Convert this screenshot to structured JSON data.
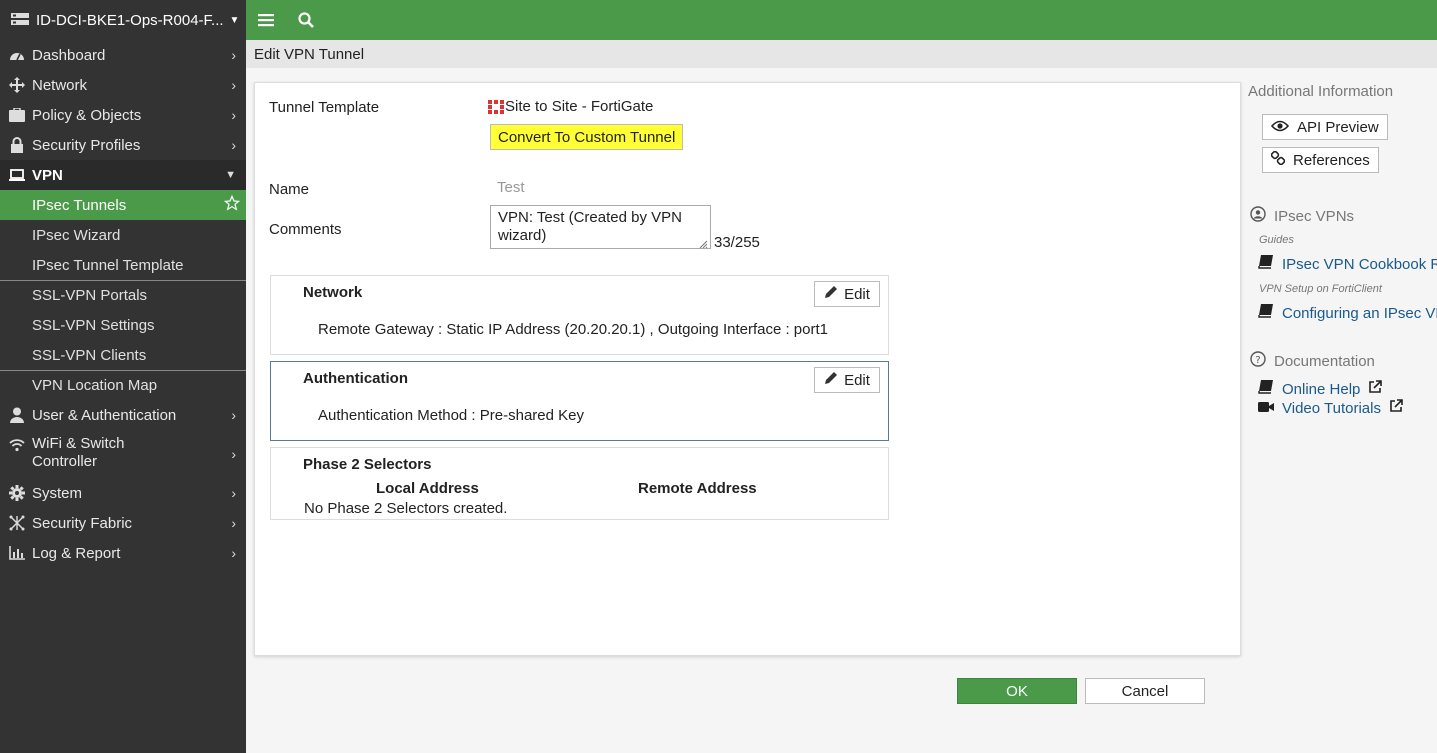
{
  "device": {
    "name": "ID-DCI-BKE1-Ops-R004-F..."
  },
  "nav": {
    "dashboard": "Dashboard",
    "network": "Network",
    "policy": "Policy & Objects",
    "security_profiles": "Security Profiles",
    "vpn": "VPN",
    "vpn_items": {
      "ipsec_tunnels": "IPsec Tunnels",
      "ipsec_wizard": "IPsec Wizard",
      "ipsec_tunnel_template": "IPsec Tunnel Template",
      "ssl_vpn_portals": "SSL-VPN Portals",
      "ssl_vpn_settings": "SSL-VPN Settings",
      "ssl_vpn_clients": "SSL-VPN Clients",
      "vpn_location_map": "VPN Location Map"
    },
    "user_auth": "User & Authentication",
    "wifi_line1": "WiFi & Switch",
    "wifi_line2": "Controller",
    "system": "System",
    "security_fabric": "Security Fabric",
    "log_report": "Log & Report"
  },
  "page": {
    "title": "Edit VPN Tunnel"
  },
  "form": {
    "tunnel_template_label": "Tunnel Template",
    "tunnel_template_value": "Site to Site - FortiGate",
    "convert_button": "Convert To Custom Tunnel",
    "name_label": "Name",
    "name_value": "Test",
    "comments_label": "Comments",
    "comments_value": "VPN: Test (Created by VPN wizard)",
    "comments_count": "33/255"
  },
  "sections": {
    "network": {
      "title": "Network",
      "edit": "Edit",
      "body": "Remote Gateway : Static IP Address (20.20.20.1) , Outgoing Interface : port1"
    },
    "auth": {
      "title": "Authentication",
      "edit": "Edit",
      "body": "Authentication Method : Pre-shared Key"
    },
    "phase2": {
      "title": "Phase 2 Selectors",
      "col_local": "Local Address",
      "col_remote": "Remote Address",
      "empty": "No Phase 2 Selectors created."
    }
  },
  "info": {
    "header": "Additional Information",
    "api_preview": "API Preview",
    "references": "References",
    "ipsec_vpns": "IPsec VPNs",
    "guides": "Guides",
    "cookbook": "IPsec VPN Cookbook Re",
    "forticlient_caption": "VPN Setup on FortiClient",
    "configuring": "Configuring an IPsec VP",
    "documentation": "Documentation",
    "online_help": "Online Help",
    "video_tutorials": "Video Tutorials"
  },
  "footer": {
    "ok": "OK",
    "cancel": "Cancel"
  },
  "colors": {
    "brand_green": "#4a9a4a",
    "sidebar_bg": "#333333",
    "highlight_yellow": "#ffff33",
    "link_blue": "#1a5a8a"
  }
}
